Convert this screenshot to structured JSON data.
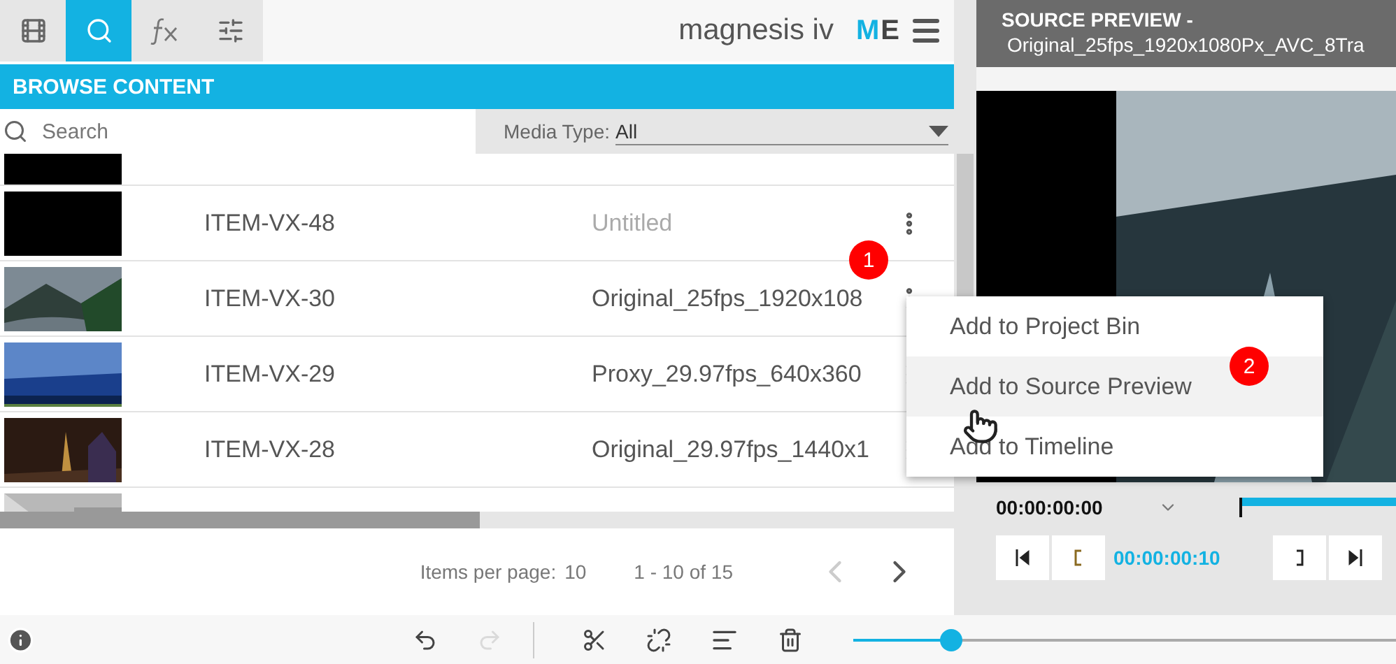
{
  "top_tabs": [
    {
      "kind": "film",
      "selected": false
    },
    {
      "kind": "search",
      "selected": true
    },
    {
      "kind": "fx",
      "selected": false
    },
    {
      "kind": "sliders",
      "selected": false
    }
  ],
  "brand": "magnesis iv",
  "user_initials": [
    "M",
    "E"
  ],
  "browse_title": "BROWSE CONTENT",
  "search": {
    "placeholder": "Search"
  },
  "media_type": {
    "label": "Media Type:",
    "value": "All"
  },
  "rows": [
    {
      "id": "ITEM-VX-48",
      "title": "Untitled",
      "untitled": true
    },
    {
      "id": "ITEM-VX-30",
      "title": "Original_25fps_1920x108",
      "untitled": false
    },
    {
      "id": "ITEM-VX-29",
      "title": "Proxy_29.97fps_640x360",
      "untitled": false
    },
    {
      "id": "ITEM-VX-28",
      "title": "Original_29.97fps_1440x1",
      "untitled": false
    }
  ],
  "pagination": {
    "label": "Items per page:",
    "per_page": "10",
    "range": "1 - 10 of 15",
    "prev_disabled": true,
    "next_disabled": false
  },
  "menu": [
    {
      "label": "Add to Project Bin",
      "selected": false
    },
    {
      "label": "Add to Source Preview",
      "selected": true
    },
    {
      "label": "Add to Timeline",
      "selected": false
    }
  ],
  "badges": [
    "1",
    "2"
  ],
  "preview": {
    "title": "SOURCE PREVIEW -",
    "file": "Original_25fps_1920x1080Px_AVC_8Tra",
    "timecode": "00:00:00:00",
    "duration": "00:00:00:10"
  },
  "tools": [
    {
      "kind": "undo",
      "disabled": false
    },
    {
      "kind": "redo",
      "disabled": true
    },
    {
      "kind": "cut",
      "disabled": false
    },
    {
      "kind": "unlink",
      "disabled": false
    },
    {
      "kind": "align",
      "disabled": false
    },
    {
      "kind": "delete",
      "disabled": false
    }
  ],
  "zoom": {
    "level": 0.18
  }
}
